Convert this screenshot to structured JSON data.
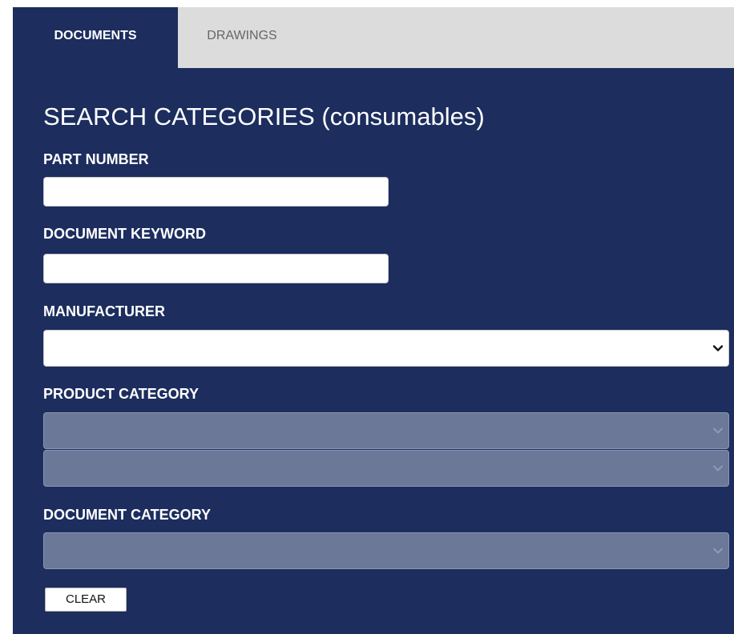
{
  "tabs": {
    "documents": "DOCUMENTS",
    "drawings": "DRAWINGS",
    "active": "documents"
  },
  "heading": "SEARCH CATEGORIES (consumables)",
  "fields": {
    "part_number": {
      "label": "PART NUMBER",
      "value": ""
    },
    "document_keyword": {
      "label": "DOCUMENT KEYWORD",
      "value": ""
    },
    "manufacturer": {
      "label": "MANUFACTURER",
      "selected": "",
      "enabled": true
    },
    "product_category": {
      "label": "PRODUCT CATEGORY",
      "level1_selected": "",
      "level2_selected": "",
      "enabled": false
    },
    "document_category": {
      "label": "DOCUMENT CATEGORY",
      "selected": "",
      "enabled": false
    }
  },
  "clear_button": "CLEAR",
  "icons": {
    "dropdown": "chevron-down-icon"
  },
  "colors": {
    "panel_background": "#1c2d5e",
    "tab_bar_background": "#dcdcdc",
    "inactive_tab_text": "#666666",
    "disabled_select": "#6b7898",
    "enabled_chevron": "#111111",
    "disabled_chevron": "#8e9ab5"
  }
}
